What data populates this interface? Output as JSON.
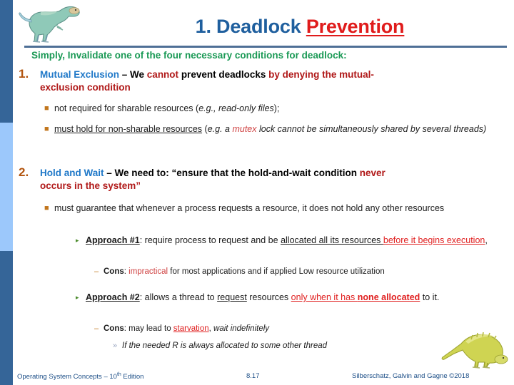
{
  "title": {
    "part1": "1. Deadlock ",
    "part2": "Prevention"
  },
  "subtitle": "Simply, Invalidate one of the four necessary conditions for deadlock:",
  "items": [
    {
      "number": "1.",
      "seg_title": "Mutual Exclusion",
      "seg_dash": " – We ",
      "seg_cannot": "cannot",
      "seg_mid": " prevent deadlocks ",
      "seg_red": "by denying the mutual-",
      "seg_red2": "exclusion condition",
      "subs": [
        {
          "pre": "not required for sharable resources (",
          "ital": "e.g., read-only files",
          "post": ");"
        },
        {
          "pre_u": "must hold for non-sharable resources",
          "mid": " (",
          "ital1": "e.g. a ",
          "mutex": "mutex",
          "ital2": " lock cannot be simultaneously shared by several threads",
          "post": ")"
        }
      ]
    },
    {
      "number": "2.",
      "seg_title": "Hold and Wait",
      "seg_dash": " – We need to: “ensure that the hold-and-wait condition ",
      "seg_red": "never",
      "seg_red2": "occurs in the system”",
      "subs": [
        {
          "text": "must guarantee that whenever a process requests a resource, it does not hold any other resources"
        }
      ]
    }
  ],
  "approaches": [
    {
      "label": "Approach #1",
      "colon": ": require process to request and be ",
      "under": "allocated all its resources ",
      "redunder": "before it begins execution",
      "tail": ",",
      "cons_label": "Cons",
      "cons_colon": ": ",
      "cons_red": "impractical",
      "cons_rest": " for most applications and if applied Low resource utilization"
    },
    {
      "label": "Approach #2",
      "colon": ": allows a thread to ",
      "under": "request",
      "mid": " resources ",
      "redunder": "only when it has ",
      "redbold": "none allocated",
      "tail": " to it.",
      "cons_label": "Cons",
      "cons_colon": ": may lead to ",
      "cons_red": "starvation",
      "cons_rest": ", ",
      "cons_ital": "wait indefinitely",
      "deep": "If the needed R is always allocated to some other thread"
    }
  ],
  "footer": {
    "left_a": "Operating System Concepts – 10",
    "left_sup": "th",
    "left_b": " Edition",
    "page": "8.17",
    "right": "Silberschatz, Galvin and Gagne ©2018"
  },
  "colors": {
    "rail_dark": "#356598",
    "rail_light": "#9cc8fb",
    "title_blue": "#1f5f9e",
    "title_red": "#e01b1b",
    "subtitle_green": "#1a9955",
    "number_brown": "#b2540e",
    "heading_blue": "#1f78c8",
    "emphasis_red": "#b01818",
    "footer_blue": "#1c4e87"
  }
}
